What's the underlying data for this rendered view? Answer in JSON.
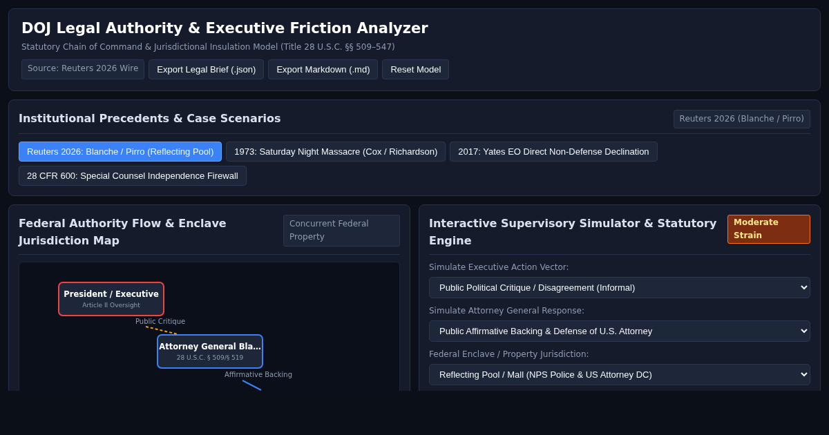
{
  "header": {
    "title": "DOJ Legal Authority & Executive Friction Analyzer",
    "subtitle": "Statutory Chain of Command & Jurisdictional Insulation Model (Title 28 U.S.C. §§ 509–547)",
    "source": "Source: Reuters 2026 Wire",
    "buttons": [
      "Export Legal Brief (.json)",
      "Export Markdown (.md)",
      "Reset Model"
    ]
  },
  "precedents": {
    "title": "Institutional Precedents & Case Scenarios",
    "badge": "Reuters 2026 (Blanche / Pirro)",
    "scenarios": [
      {
        "label": "Reuters 2026: Blanche / Pirro (Reflecting Pool)",
        "selected": true
      },
      {
        "label": "1973: Saturday Night Massacre (Cox / Richardson)",
        "selected": false
      },
      {
        "label": "2017: Yates EO Direct Non-Defense Declination",
        "selected": false
      },
      {
        "label": "28 CFR 600: Special Counsel Independence Firewall",
        "selected": false
      }
    ]
  },
  "map": {
    "title": "Federal Authority Flow & Enclave Jurisdiction Map",
    "badge": "Concurrent Federal Property",
    "nodes": [
      {
        "label": "President / Executive",
        "sub": "Article II Oversight",
        "color": "#ef4444"
      },
      {
        "label": "Attorney General Bla…",
        "sub": "28 U.S.C. § 509/§ 519",
        "color": "#3b82f6"
      }
    ],
    "edges": [
      {
        "label": "Public Critique",
        "kind": "dashed",
        "color": "#f59e0b"
      },
      {
        "label": "Affirmative Backing",
        "kind": "solid",
        "color": "#3b82f6"
      }
    ]
  },
  "simulator": {
    "title": "Interactive Supervisory Simulator & Statutory Engine",
    "strain": {
      "label": "Moderate Strain"
    },
    "fields": [
      {
        "label": "Simulate Executive Action Vector:",
        "value": "Public Political Critique / Disagreement (Informal)"
      },
      {
        "label": "Simulate Attorney General Response:",
        "value": "Public Affirmative Backing & Defense of U.S. Attorney"
      },
      {
        "label": "Federal Enclave / Property Jurisdiction:",
        "value": "Reflecting Pool / Mall (NPS Police & US Attorney DC)"
      }
    ]
  }
}
